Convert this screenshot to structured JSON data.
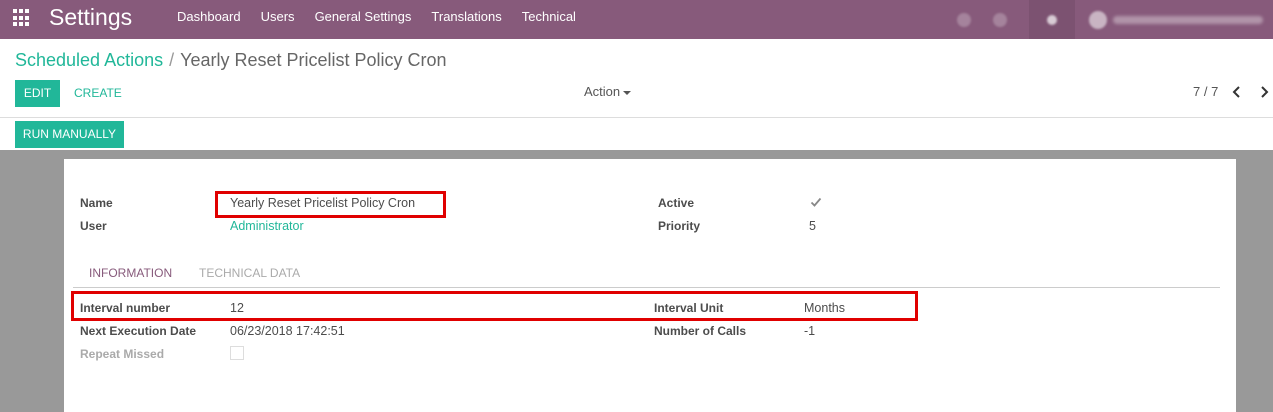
{
  "navbar": {
    "brand": "Settings",
    "menu": [
      "Dashboard",
      "Users",
      "General Settings",
      "Translations",
      "Technical"
    ]
  },
  "breadcrumb": {
    "parent": "Scheduled Actions",
    "separator": "/",
    "current": "Yearly Reset Pricelist Policy Cron"
  },
  "toolbar": {
    "edit_label": "EDIT",
    "create_label": "CREATE",
    "action_label": "Action",
    "pager": "7 / 7"
  },
  "header_buttons": {
    "run_manually": "RUN MANUALLY"
  },
  "form": {
    "name_label": "Name",
    "name_value": "Yearly Reset Pricelist Policy Cron",
    "user_label": "User",
    "user_value": "Administrator",
    "active_label": "Active",
    "active_checked": true,
    "priority_label": "Priority",
    "priority_value": "5"
  },
  "tabs": {
    "information": "INFORMATION",
    "technical": "TECHNICAL DATA"
  },
  "information": {
    "interval_number_label": "Interval number",
    "interval_number_value": "12",
    "interval_unit_label": "Interval Unit",
    "interval_unit_value": "Months",
    "next_exec_label": "Next Execution Date",
    "next_exec_value": "06/23/2018 17:42:51",
    "num_calls_label": "Number of Calls",
    "num_calls_value": "-1",
    "repeat_missed_label": "Repeat Missed",
    "repeat_missed_checked": false
  },
  "colors": {
    "navbar": "#875a7b",
    "accent": "#21b799",
    "highlight": "#e00000"
  }
}
